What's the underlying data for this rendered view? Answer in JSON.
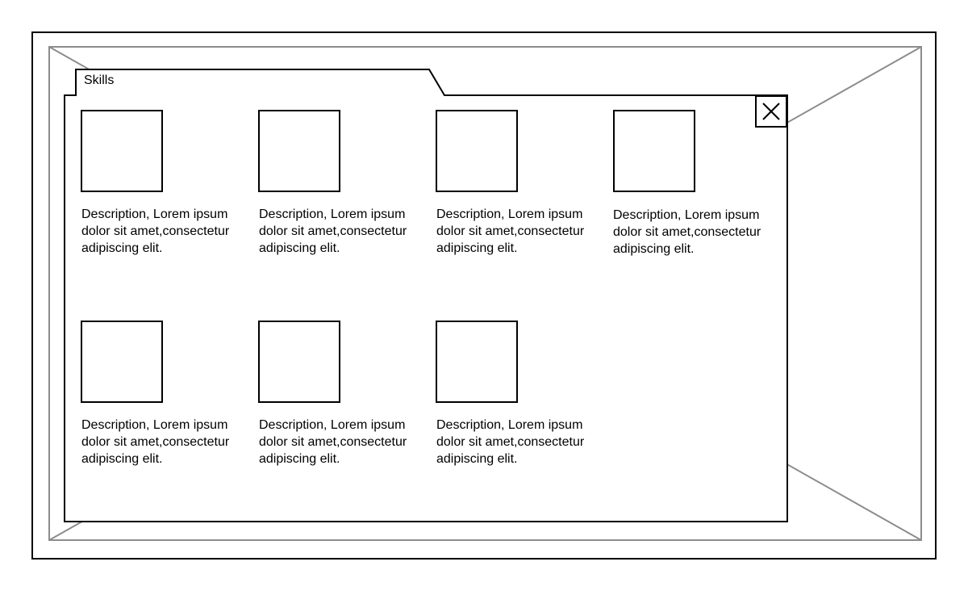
{
  "panel": {
    "tab_label": "Skills",
    "close": {
      "icon": "close-icon"
    }
  },
  "skills": [
    {
      "description": "Description, Lorem ipsum\ndolor sit amet,consectetur\nadipiscing elit."
    },
    {
      "description": "Description, Lorem ipsum\ndolor sit amet,consectetur\nadipiscing elit."
    },
    {
      "description": "Description, Lorem ipsum\ndolor sit amet,consectetur\nadipiscing elit."
    },
    {
      "description": "Description, Lorem ipsum\ndolor sit amet,consectetur\nadipiscing elit."
    },
    {
      "description": "Description, Lorem ipsum\ndolor sit amet,consectetur\nadipiscing elit."
    },
    {
      "description": "Description, Lorem ipsum\ndolor sit amet,consectetur\nadipiscing elit."
    },
    {
      "description": "Description, Lorem ipsum\ndolor sit amet,consectetur\nadipiscing elit."
    }
  ]
}
